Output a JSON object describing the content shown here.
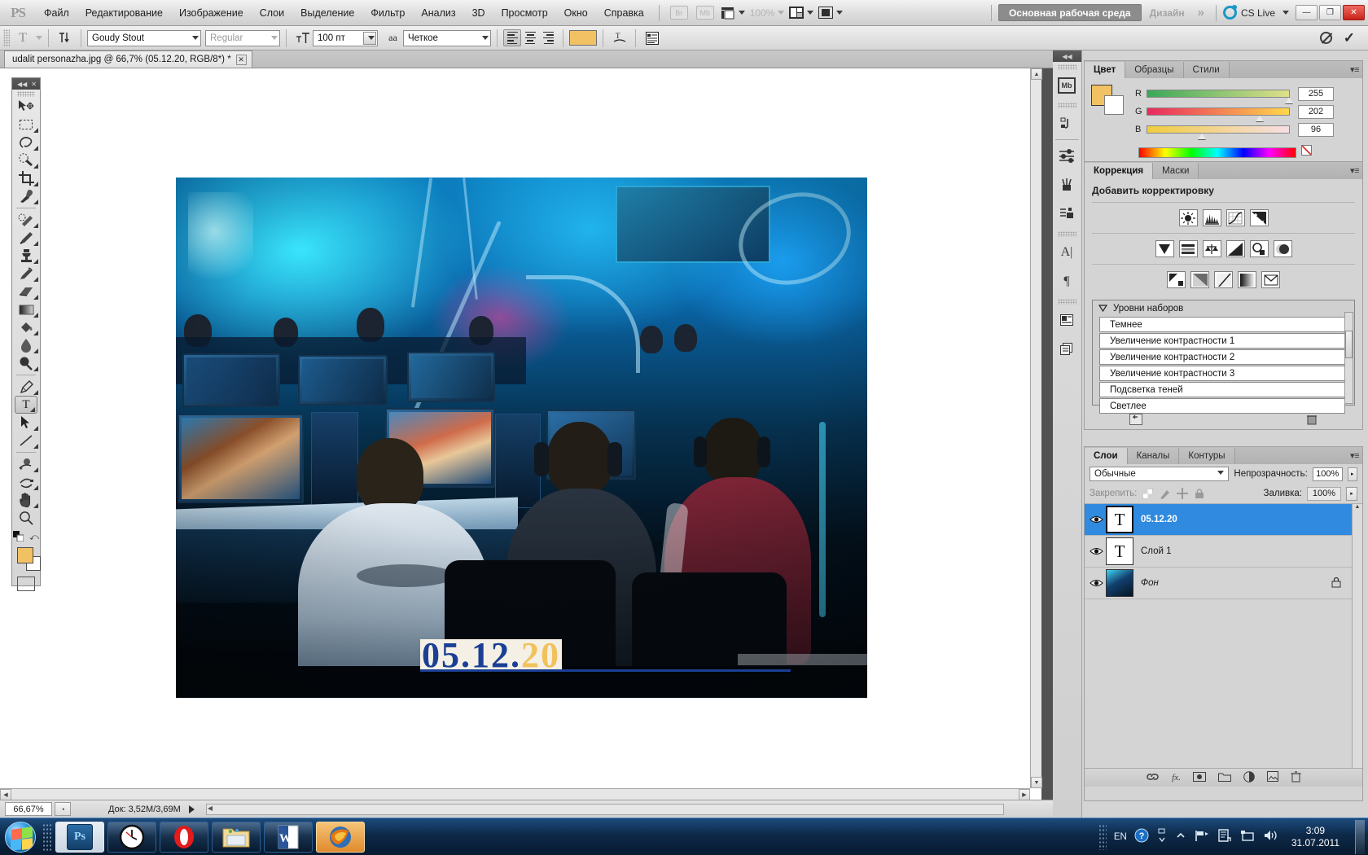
{
  "app": {
    "name": "Adobe Photoshop",
    "logo": "PS"
  },
  "menubar": {
    "items": [
      "Файл",
      "Редактирование",
      "Изображение",
      "Слои",
      "Выделение",
      "Фильтр",
      "Анализ",
      "3D",
      "Просмотр",
      "Окно",
      "Справка"
    ],
    "bridge_label": "Br",
    "minibridge_label": "Mb",
    "zoom_label": "100%",
    "workspace_active": "Основная рабочая среда",
    "workspace_other": "Дизайн",
    "more_chevrons": "»",
    "cslive_label": "CS Live",
    "window_buttons": {
      "minimize": "—",
      "restore": "❐",
      "close": "✕"
    }
  },
  "optionsbar": {
    "tool_icon": "T",
    "orientation_icon": "⇵T",
    "font_family": "Goudy Stout",
    "font_style": "Regular",
    "size_icon": "ᴛT",
    "font_size": "100 пт",
    "aa_icon": "aa",
    "antialias": "Четкое",
    "align_left": "align-left",
    "align_center": "align-center",
    "align_right": "align-right",
    "text_color": "#f2c164",
    "warp_icon": "warp-text",
    "panels_icon": "char-paragraph-panels",
    "cancel_title": "Отмена",
    "commit_title": "Применить",
    "commit_glyph": "✓"
  },
  "document": {
    "tab_title": "udalit personazha.jpg @ 66,7% (05.12.20, RGB/8*) *",
    "close_glyph": "✕",
    "date_text_blue": "05.12.",
    "date_text_gold": "20"
  },
  "statusbar": {
    "zoom": "66,67%",
    "clock_icon": "timing-icon",
    "doc_info": "Док: 3,52M/3,69M",
    "expand_glyph": "▶"
  },
  "toolbox": {
    "collapse_glyph": "◀◀",
    "close_glyph": "✕",
    "tools": [
      {
        "name": "move-tool",
        "glyph": "➤",
        "sub": false
      },
      {
        "name": "marquee-tool",
        "glyph": "▭",
        "sub": true
      },
      {
        "name": "lasso-tool",
        "glyph": "◯",
        "sub": true
      },
      {
        "name": "quick-selection-tool",
        "glyph": "✑",
        "sub": true
      },
      {
        "name": "crop-tool",
        "glyph": "⌗",
        "sub": true
      },
      {
        "name": "eyedropper-tool",
        "glyph": "✒",
        "sub": true
      },
      {
        "name": "healing-brush-tool",
        "glyph": "✚",
        "sub": true
      },
      {
        "name": "brush-tool",
        "glyph": "✎",
        "sub": true
      },
      {
        "name": "clone-stamp-tool",
        "glyph": "⚒",
        "sub": true
      },
      {
        "name": "history-brush-tool",
        "glyph": "✥",
        "sub": true
      },
      {
        "name": "eraser-tool",
        "glyph": "▰",
        "sub": true
      },
      {
        "name": "gradient-tool",
        "glyph": "◣",
        "sub": true
      },
      {
        "name": "paint-bucket-tool",
        "glyph": "⬗",
        "sub": true
      },
      {
        "name": "blur-tool",
        "glyph": "💧",
        "sub": true
      },
      {
        "name": "dodge-tool",
        "glyph": "⚫",
        "sub": true
      },
      {
        "name": "pen-tool",
        "glyph": "✐",
        "sub": true
      },
      {
        "name": "type-tool",
        "glyph": "T",
        "sub": true
      },
      {
        "name": "path-selection-tool",
        "glyph": "➤",
        "sub": true
      },
      {
        "name": "line-tool",
        "glyph": "╱",
        "sub": true
      },
      {
        "name": "3d-rotate-tool",
        "glyph": "◔",
        "sub": true
      },
      {
        "name": "3d-orbit-tool",
        "glyph": "◑",
        "sub": true
      },
      {
        "name": "hand-tool",
        "glyph": "✋",
        "sub": true
      },
      {
        "name": "zoom-tool",
        "glyph": "🔍",
        "sub": false
      }
    ],
    "foreground_color": "#f2c164",
    "background_color": "#ffffff",
    "swap_glyph": "⤺",
    "quickmask_name": "quick-mask-toggle"
  },
  "dockbar": {
    "collapse_glyph": "◀◀",
    "icons": [
      {
        "name": "mini-bridge-icon",
        "glyph": "Mb"
      },
      {
        "name": "history-icon",
        "glyph": "⎌"
      },
      {
        "name": "adjustments-icon",
        "glyph": "◑"
      },
      {
        "name": "brush-presets-icon",
        "glyph": "🖌"
      },
      {
        "name": "clone-source-icon",
        "glyph": "⎘"
      },
      {
        "name": "character-icon",
        "glyph": "A|"
      },
      {
        "name": "paragraph-icon",
        "glyph": "¶"
      },
      {
        "name": "layer-comps-icon",
        "glyph": "▤"
      },
      {
        "name": "duplicate-icon",
        "glyph": "❐"
      }
    ]
  },
  "color_panel": {
    "tabs": [
      "Цвет",
      "Образцы",
      "Стили"
    ],
    "active_tab": "Цвет",
    "menu_glyph": "▾≡",
    "foreground": "#ffca60",
    "background": "#ffffff",
    "channels": [
      {
        "label": "R",
        "value": "255",
        "pct": 100
      },
      {
        "label": "G",
        "value": "202",
        "pct": 79
      },
      {
        "label": "B",
        "value": "96",
        "pct": 38
      }
    ]
  },
  "adjustments_panel": {
    "tabs": [
      "Коррекция",
      "Маски"
    ],
    "active_tab": "Коррекция",
    "title": "Добавить корректировку",
    "row1": [
      "brightness-contrast-icon",
      "levels-icon",
      "curves-icon",
      "exposure-icon"
    ],
    "row2": [
      "vibrance-icon",
      "hue-saturation-icon",
      "color-balance-icon",
      "black-white-icon",
      "photo-filter-icon",
      "channel-mixer-icon"
    ],
    "row3": [
      "invert-icon",
      "posterize-icon",
      "threshold-icon",
      "gradient-map-icon",
      "selective-color-icon"
    ],
    "presets_header": "Уровни наборов",
    "presets": [
      "Темнее",
      "Увеличение контрастности 1",
      "Увеличение контрастности 2",
      "Увеличение контрастности 3",
      "Подсветка теней",
      "Светлее"
    ],
    "footer_left_icon": "return-to-adjustment-list-icon",
    "footer_right_icon": "delete-adjustment-icon"
  },
  "layers_panel": {
    "tabs": [
      "Слои",
      "Каналы",
      "Контуры"
    ],
    "active_tab": "Слои",
    "menu_glyph": "▾≡",
    "blend_mode": "Обычные",
    "opacity_label": "Непрозрачность:",
    "opacity_value": "100%",
    "lock_label": "Закрепить:",
    "fill_label": "Заливка:",
    "fill_value": "100%",
    "lock_icons": [
      "lock-transparency-icon",
      "lock-image-icon",
      "lock-position-icon",
      "lock-all-icon"
    ],
    "layers": [
      {
        "name": "05.12.20",
        "thumb": "T",
        "selected": true,
        "locked": false,
        "italic": false
      },
      {
        "name": "Слой 1",
        "thumb": "T",
        "selected": false,
        "locked": false,
        "italic": false
      },
      {
        "name": "Фон",
        "thumb": "photo",
        "selected": false,
        "locked": true,
        "italic": true
      }
    ],
    "footer_icons": [
      "link-layers-icon",
      "layer-style-icon",
      "layer-mask-icon",
      "new-group-icon",
      "new-adjustment-icon",
      "new-layer-icon",
      "delete-layer-icon"
    ]
  },
  "taskbar": {
    "start_name": "start-orb",
    "buttons": [
      {
        "name": "taskbar-photoshop",
        "glyph": "Ps",
        "state": "active"
      },
      {
        "name": "taskbar-clock-app",
        "glyph": "🕐",
        "state": "normal"
      },
      {
        "name": "taskbar-opera",
        "glyph": "O",
        "state": "normal"
      },
      {
        "name": "taskbar-explorer",
        "glyph": "🗂",
        "state": "normal"
      },
      {
        "name": "taskbar-word",
        "glyph": "W",
        "state": "normal"
      },
      {
        "name": "taskbar-firefox",
        "glyph": "🦊",
        "state": "hot"
      }
    ],
    "tray": {
      "language": "EN",
      "help_glyph": "?",
      "show_hidden_glyph": "▲",
      "icons": [
        "network-icon",
        "action-center-icon",
        "safely-remove-icon",
        "volume-icon"
      ],
      "time": "3:09",
      "date": "31.07.2011"
    }
  }
}
